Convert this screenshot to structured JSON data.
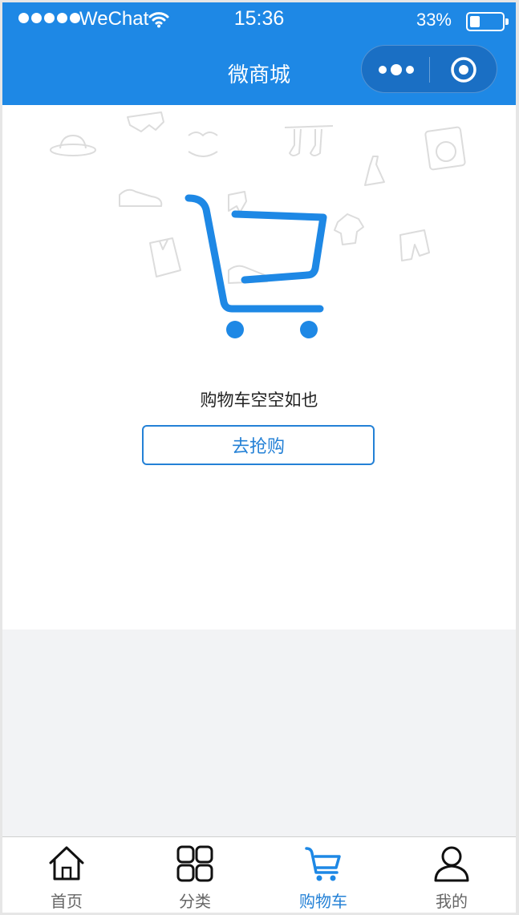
{
  "status_bar": {
    "carrier": "WeChat",
    "time": "15:36",
    "battery": "33%",
    "battery_level": 0.33
  },
  "nav": {
    "title": "微商城",
    "more_icon": "more-dots-icon",
    "close_icon": "target-circle-icon"
  },
  "cart": {
    "empty_text": "购物车空空如也",
    "go_button": "去抢购",
    "illustration_icon": "shopping-cart-icon",
    "accent_color": "#1e88e5"
  },
  "tabbar": {
    "tabs": [
      {
        "label": "首页",
        "icon": "home-icon",
        "active": false
      },
      {
        "label": "分类",
        "icon": "category-grid-icon",
        "active": false
      },
      {
        "label": "购物车",
        "icon": "cart-icon",
        "active": true
      },
      {
        "label": "我的",
        "icon": "user-icon",
        "active": false
      }
    ],
    "active_color": "#2481d6"
  }
}
